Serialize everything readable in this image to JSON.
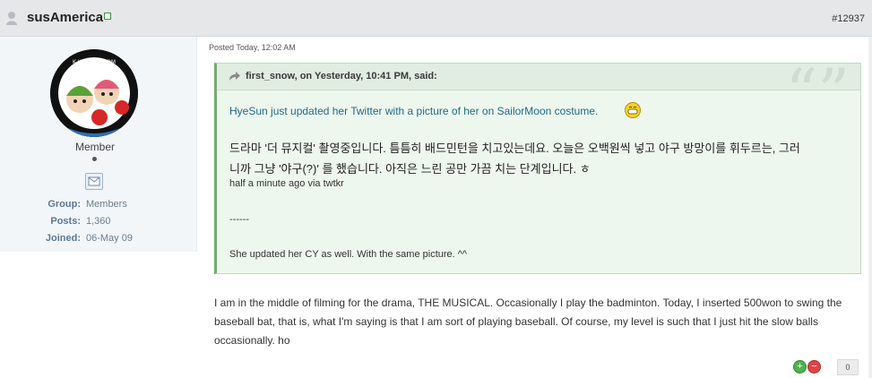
{
  "post": {
    "username": "susAmerica",
    "post_number": "#12937",
    "posted": "Posted Today, 12:02 AM"
  },
  "profile": {
    "rank": "Member",
    "group_label": "Group:",
    "group_value": "Members",
    "posts_label": "Posts:",
    "posts_value": "1,360",
    "joined_label": "Joined:",
    "joined_value": "06-May 09",
    "avatar_text": "K-HOOMPS.COM"
  },
  "quote": {
    "header": "first_snow, on Yesterday, 10:41 PM, said:",
    "link_text": "HyeSun just updated her Twitter with a picture of her on SailorMoon costume.",
    "korean_line1": "드라마 '더 뮤지컬' 촬영중입니다. 틈틈히 배드민턴을 치고있는데요. 오늘은 오백원씩 넣고 야구 방망이를 휘두르는, 그러",
    "korean_line2": "니까 그냥 '야구(?)' 를 했습니다. 아직은 느린 공만 가끔 치는 단계입니다. ㅎ",
    "via": "half a minute ago via twtkr",
    "divider": "------",
    "cy_line": "She updated her CY as well. With the same picture. ^^"
  },
  "body": {
    "text": "I am in the middle of filming for the drama, THE MUSICAL. Occasionally I play the badminton. Today, I inserted 500won to swing the baseball bat, that is, what I'm saying is that I am sort of playing baseball. Of course, my level is such that I just hit the slow balls occasionally. ho"
  },
  "reputation": {
    "plus": "+",
    "minus": "−",
    "count": "0"
  },
  "colors": {
    "header_bg": "#e6e7e9",
    "sidebar_bg": "#f2f6f9",
    "quote_bg": "#eef7ee",
    "quote_border": "#74aa74",
    "link": "#1f6a86"
  }
}
